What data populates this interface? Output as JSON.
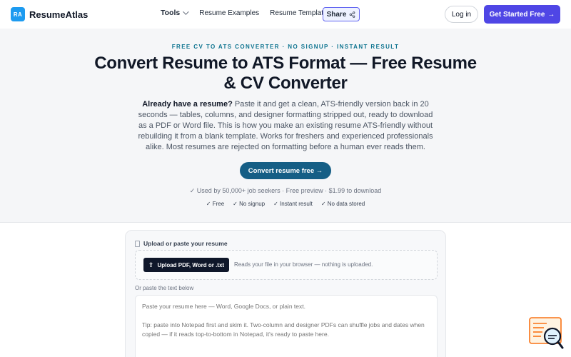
{
  "header": {
    "logo_mark": "RA",
    "logo_text": "ResumeAtlas",
    "nav": {
      "tools": "Tools",
      "resume_examples": "Resume Examples",
      "resume_templates": "Resume Templates"
    },
    "share_label": "Share",
    "login_label": "Log in",
    "cta_label": "Get Started Free",
    "cta_arrow": "→"
  },
  "hero": {
    "eyebrow": "FREE CV TO ATS CONVERTER · NO SIGNUP · INSTANT RESULT",
    "title": "Convert Resume to ATS Format — Free Resume & CV Converter",
    "desc_lead": "Already have a resume?",
    "desc_body": " Paste it and get a clean, ATS-friendly version back in 20 seconds — tables, columns, and designer formatting stripped out, ready to download as a PDF or Word file. This is how you make an existing resume ATS-friendly without rebuilding it from a blank template. Works for freshers and experienced professionals alike. Most resumes are rejected on formatting before a human ever reads them.",
    "convert_label": "Convert resume free →",
    "social_proof": "✓ Used by 50,000+ job seekers · Free preview · $1.99 to download",
    "checks": [
      "✓ Free",
      "✓ No signup",
      "✓ Instant result",
      "✓ No data stored"
    ]
  },
  "tool": {
    "heading": "Upload or paste your resume",
    "upload_label": "Upload PDF, Word or .txt",
    "upload_icon": "⇪",
    "upload_note": "Reads your file in your browser — nothing is uploaded.",
    "paste_label": "Or paste the text below",
    "paste_placeholder": "Paste your resume here — Word, Google Docs, or plain text.\n\nTip: paste into Notepad first and skim it. Two-column and designer PDFs can shuffle jobs and dates when copied — if it reads top-to-bottom in Notepad, it's ready to paste here."
  },
  "colors": {
    "brand": "#4f46e5",
    "accent": "#155e85",
    "eyebrow": "#0e7490"
  }
}
